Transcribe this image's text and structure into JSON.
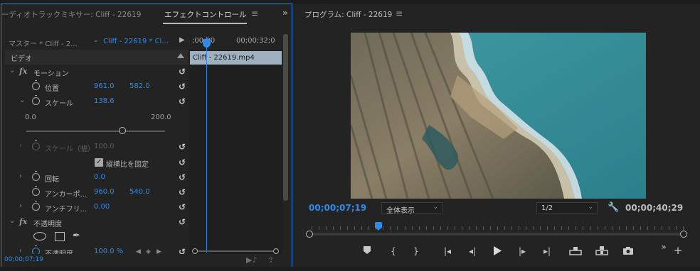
{
  "left_panel": {
    "tabs": {
      "audio_mixer": "ーディオトラックミキサー: Cliff - 22619",
      "effect_controls": "エフェクトコントロール"
    },
    "header": {
      "master": "マスター * Cliff - 2...",
      "clip": "Cliff - 22619 * Cl..."
    },
    "section_video": "ビデオ",
    "motion": {
      "label": "モーション",
      "position_label": "位置",
      "position_x": "961.0",
      "position_y": "582.0",
      "scale_label": "スケール",
      "scale_value": "138.6",
      "scale_min": "0.0",
      "scale_max": "200.0",
      "scale_slider_value": 138.6,
      "scale_width_label": "スケール（幅）",
      "scale_width_value": "100.0",
      "uniform_scale_label": "縦横比を固定",
      "rotation_label": "回転",
      "rotation_value": "0.0",
      "anchor_label": "アンカーポ...",
      "anchor_x": "960.0",
      "anchor_y": "540.0",
      "antiflicker_label": "アンチフリ...",
      "antiflicker_value": "0.00"
    },
    "opacity": {
      "label": "不透明度",
      "opacity_label": "不透明度",
      "opacity_value": "100.0 %"
    },
    "timeline": {
      "time_start": ";00;00",
      "time_end": "00;00;32;0",
      "clip_name": "Cliff - 22619.mp4"
    },
    "footer_time": "00;00;07;19"
  },
  "program": {
    "title": "プログラム: Cliff - 22619",
    "current_timecode": "00;00;07;19",
    "zoom_select": "全体表示",
    "resolution_select": "1/2",
    "duration_timecode": "00;00;40;29",
    "playhead_fraction": 0.18
  },
  "colors": {
    "accent": "#2d8ceb",
    "panel_bg": "#232323",
    "clip_bar": "#9fb0c0"
  },
  "icons": [
    "menu-icon",
    "stopwatch-icon",
    "reset-icon",
    "ellipse-mask-icon",
    "rect-mask-icon",
    "pen-mask-icon",
    "wrench-icon",
    "marker-icon",
    "mark-in-icon",
    "mark-out-icon",
    "go-to-in-icon",
    "step-back-icon",
    "play-icon",
    "step-forward-icon",
    "go-to-out-icon",
    "lift-icon",
    "extract-icon",
    "camera-icon",
    "add-button-icon"
  ]
}
